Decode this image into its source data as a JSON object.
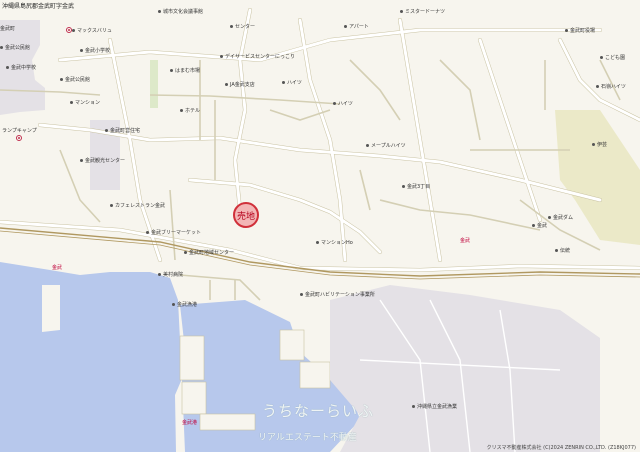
{
  "map": {
    "area_label": "沖縄県島尻郡金武町字金武",
    "property_marker": "売地",
    "watermark": "うちなーらいふ",
    "watermark_sub": "リアルエステート不動産",
    "copyright": "クリスマ不動産株式会社 (C)2024 ZENRIN CO.,LTD. (Z18KJ077)",
    "colors": {
      "sea": "#b7c8ec",
      "land": "#f7f5ee",
      "road": "#ffffff",
      "road_edge": "#c9c2a2",
      "park": "#dde9c9",
      "facility": "#e4e1e6",
      "marker": "#d0303a",
      "rail": "#b09860"
    }
  },
  "labels": {
    "l1": "城市文化会議事館",
    "l2": "マックスバリュ",
    "l3": "金武小学校",
    "l4": "金武中学校",
    "l5": "金武公民館",
    "l6": "センター",
    "l7": "はまむ市場",
    "l8": "デイサービスセンターにっこり",
    "l9": "JA金武支店",
    "l10": "ハイツ",
    "l11": "アパート",
    "l12": "ミスタードーナツ",
    "l13": "金武町役場",
    "l14": "こども園",
    "l15": "マンション",
    "l16": "金武町営住宅",
    "l17": "ハイツ",
    "l18": "カフェレストラン金武",
    "l19": "金武ブリーマーケット",
    "l20": "金武町地域センター",
    "l21": "マンションHo",
    "l22": "美村病院",
    "l23": "金武町ハビリテーション事業所",
    "l24": "金武漁港",
    "l25": "沖縄県立金武漁業",
    "l26": "金武",
    "l27": "金武",
    "l28": "金武港",
    "l29": "金武観光センター",
    "l30": "ホテル",
    "l31": "金武公民館",
    "l32": "石嶺ハイツ",
    "l33": "ランプキャンプ",
    "l34": "伊芸",
    "l35": "金武",
    "l36": "伝統",
    "l37": "メープルハイツ",
    "l38": "金武町",
    "l39": "金武3丁目",
    "l40": "金武ダム"
  }
}
